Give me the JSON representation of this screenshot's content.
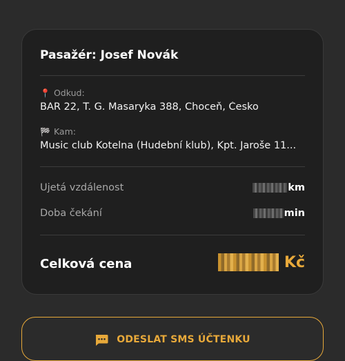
{
  "receipt": {
    "passenger": "Pasažér: Josef Novák",
    "from_label": "Odkud:",
    "from_icon": "pin-icon",
    "from_value": "BAR 22, T. G. Masaryka 388, Choceň, Česko",
    "to_label": "Kam:",
    "to_icon": "checkered-flag-icon",
    "to_value": "Music club Kotelna (Hudební klub), Kpt. Jaroše 11...",
    "distance_label": "Ujetá vzdálenost",
    "distance_unit": "km",
    "waiting_label": "Doba čekání",
    "waiting_unit": "min",
    "total_label": "Celková cena",
    "total_currency": "Kč"
  },
  "actions": {
    "sms_label": "ODESLAT SMS ÚČTENKU",
    "sms_icon": "message-icon"
  },
  "colors": {
    "accent": "#e8a93a",
    "background": "#2b2b2b",
    "card": "#1f1f1f"
  }
}
